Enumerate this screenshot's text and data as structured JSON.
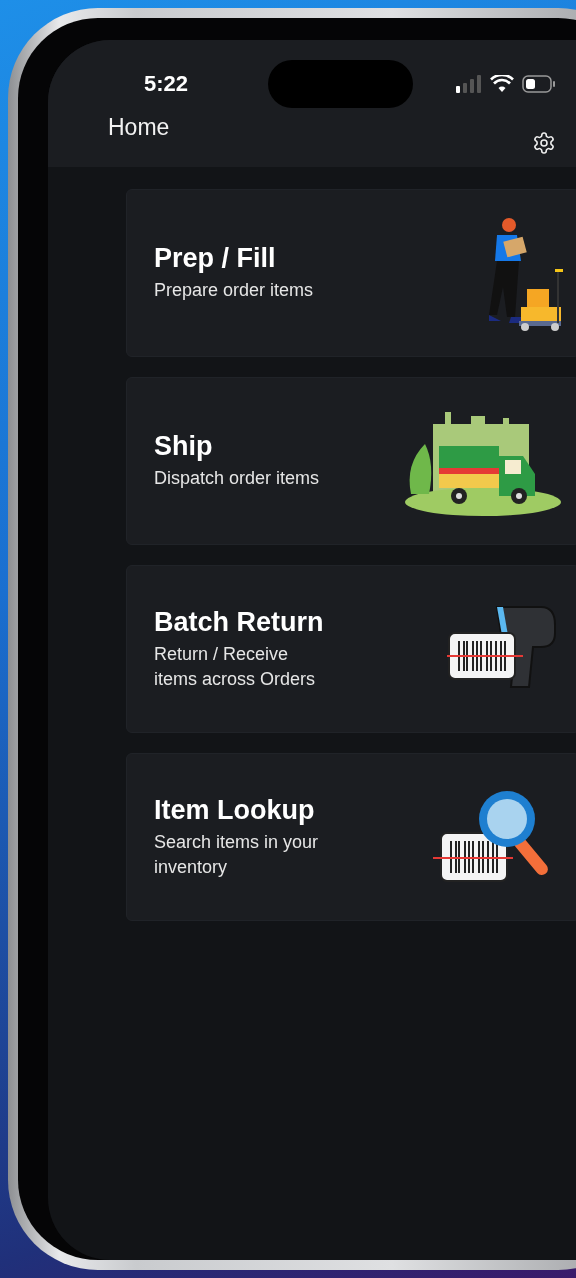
{
  "status_bar": {
    "time": "5:22"
  },
  "header": {
    "title": "Home"
  },
  "cards": [
    {
      "kind": "cart",
      "title": "Prep / Fill",
      "subtitle": "Prepare order items"
    },
    {
      "kind": "truck",
      "title": "Ship",
      "subtitle": "Dispatch order items"
    },
    {
      "kind": "scanner",
      "title": "Batch Return",
      "subtitle": "Return / Receive\nitems across Orders"
    },
    {
      "kind": "lookup",
      "title": "Item Lookup",
      "subtitle": "Search items in your\ninventory"
    }
  ]
}
